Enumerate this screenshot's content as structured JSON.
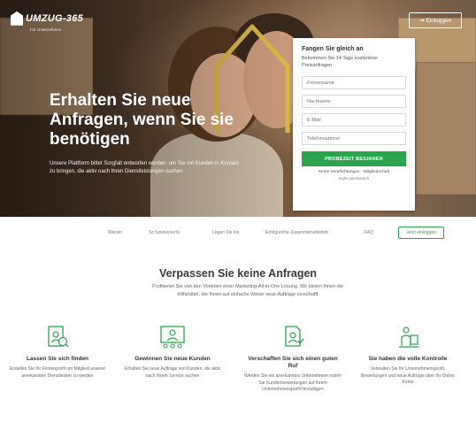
{
  "header": {
    "logo_text": "UMZUG-365",
    "logo_sub": "Für Unternehmen",
    "login_label": "Einloggen"
  },
  "hero": {
    "title": "Erhalten Sie neue Anfragen, wenn Sie sie benötigen",
    "text": "Unsere Plattform bittet Sorgfalt entworfen worden, um Sie mit Kunden in Kontakt zu bringen, die aktiv nach Ihren Dienstleistungen suchen"
  },
  "form": {
    "title": "Fangen Sie gleich an",
    "subtitle": "Bekommen Sie 14 Tage kostenlose Preisanfragen",
    "fields": [
      {
        "placeholder": "Firmenname"
      },
      {
        "placeholder": "Nachname"
      },
      {
        "placeholder": "E-Mail"
      },
      {
        "placeholder": "Telefonnummer"
      }
    ],
    "button_label": "PROBEZEIT BEGINNEN",
    "note": "Keine Verpflichtungen - Mitgliedschaft",
    "note2": "endet automatisch"
  },
  "subnav": {
    "items": [
      "Warum",
      "So funktioniert's",
      "Legen Sie los",
      "Erfolgreiche Zusammenarbeiten",
      "FAQ"
    ],
    "button_label": "Jetzt einloggen"
  },
  "section": {
    "title": "Verpassen Sie keine Anfragen",
    "text": "Profitieren Sie von den Vorteilen einer Marketing-All-in-One Lösung. Wir bieten Ihnen die Hilfsmittel, die Ihnen auf einfache Weise neue Aufträge verschafft"
  },
  "features": [
    {
      "icon": "profile-icon",
      "title": "Lassen Sie sich finden",
      "text": "Erstellen Sie Ihr Firmenprofil um Mitglied unserer anerkannten Dienstleister zu werden"
    },
    {
      "icon": "customers-icon",
      "title": "Gewinnen Sie neue Kunden",
      "text": "Erhalten Sie neue Aufträge von Kunden, die aktiv nach Ihrem Service suchen"
    },
    {
      "icon": "reputation-icon",
      "title": "Verschaffen Sie sich einen guten Ruf",
      "text": "Werden Sie ein anerkanntes Unternehmen indem Sie Kundenbewertungen auf Ihrem Unternehmensprofil hinzufügen"
    },
    {
      "icon": "control-icon",
      "title": "Sie haben die volle Kontrolle",
      "text": "Verwalten Sie Ihr Unternehmensprofil, Bewertungen und neue Aufträge über Ihr Online Konto"
    }
  ],
  "colors": {
    "accent": "#2ca44f",
    "title": "#3a3a3a"
  }
}
